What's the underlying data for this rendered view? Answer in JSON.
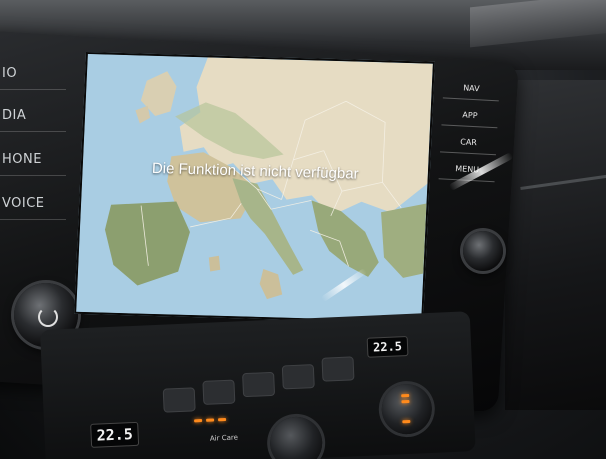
{
  "infotainment": {
    "left_buttons": [
      "IO",
      "DIA",
      "HONE",
      "VOICE"
    ],
    "screen_message": "Die Funktion ist nicht verfügbar",
    "right_menu": [
      "NAV",
      "APP",
      "CAR",
      "MENU"
    ]
  },
  "climate": {
    "temp_left": "22.5",
    "temp_right": "22.5",
    "air_care_label": "Air Care"
  },
  "colors": {
    "map_sea": "#a9cde3",
    "map_land": "#e6dcc3",
    "map_green": "#8c9f6f",
    "indicator": "#ff8a1c"
  }
}
